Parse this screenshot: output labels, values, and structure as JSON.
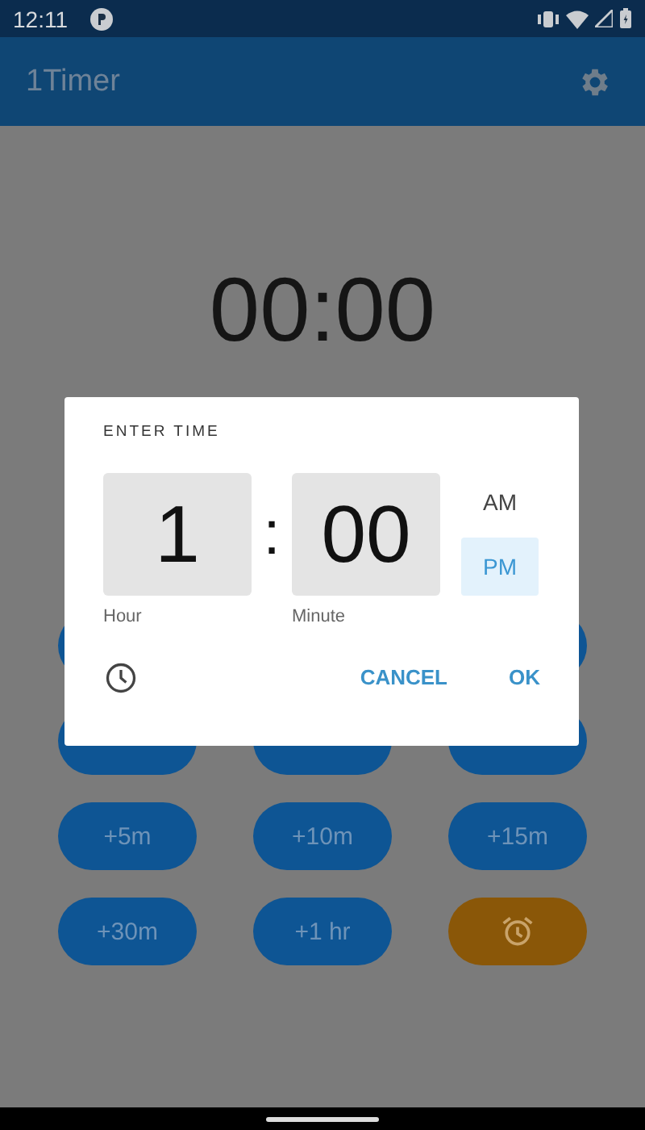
{
  "status_bar": {
    "time": "12:11"
  },
  "app_bar": {
    "title": "1Timer"
  },
  "timer": {
    "display": "00:00"
  },
  "buttons": [
    {
      "kind": "covered"
    },
    {
      "kind": "gap"
    },
    {
      "kind": "covered"
    },
    {
      "kind": "covered"
    },
    {
      "kind": "covered"
    },
    {
      "kind": "covered"
    },
    {
      "kind": "add",
      "label": "+5m"
    },
    {
      "kind": "add",
      "label": "+10m"
    },
    {
      "kind": "add",
      "label": "+15m"
    },
    {
      "kind": "add",
      "label": "+30m"
    },
    {
      "kind": "add",
      "label": "+1 hr"
    },
    {
      "kind": "alarm"
    }
  ],
  "dialog": {
    "title": "ENTER TIME",
    "hour": {
      "value": "1",
      "label": "Hour"
    },
    "separator": ":",
    "minute": {
      "value": "00",
      "label": "Minute"
    },
    "periods": [
      {
        "label": "AM",
        "selected": false
      },
      {
        "label": "PM",
        "selected": true
      }
    ],
    "actions": [
      "CANCEL",
      "OK"
    ]
  }
}
